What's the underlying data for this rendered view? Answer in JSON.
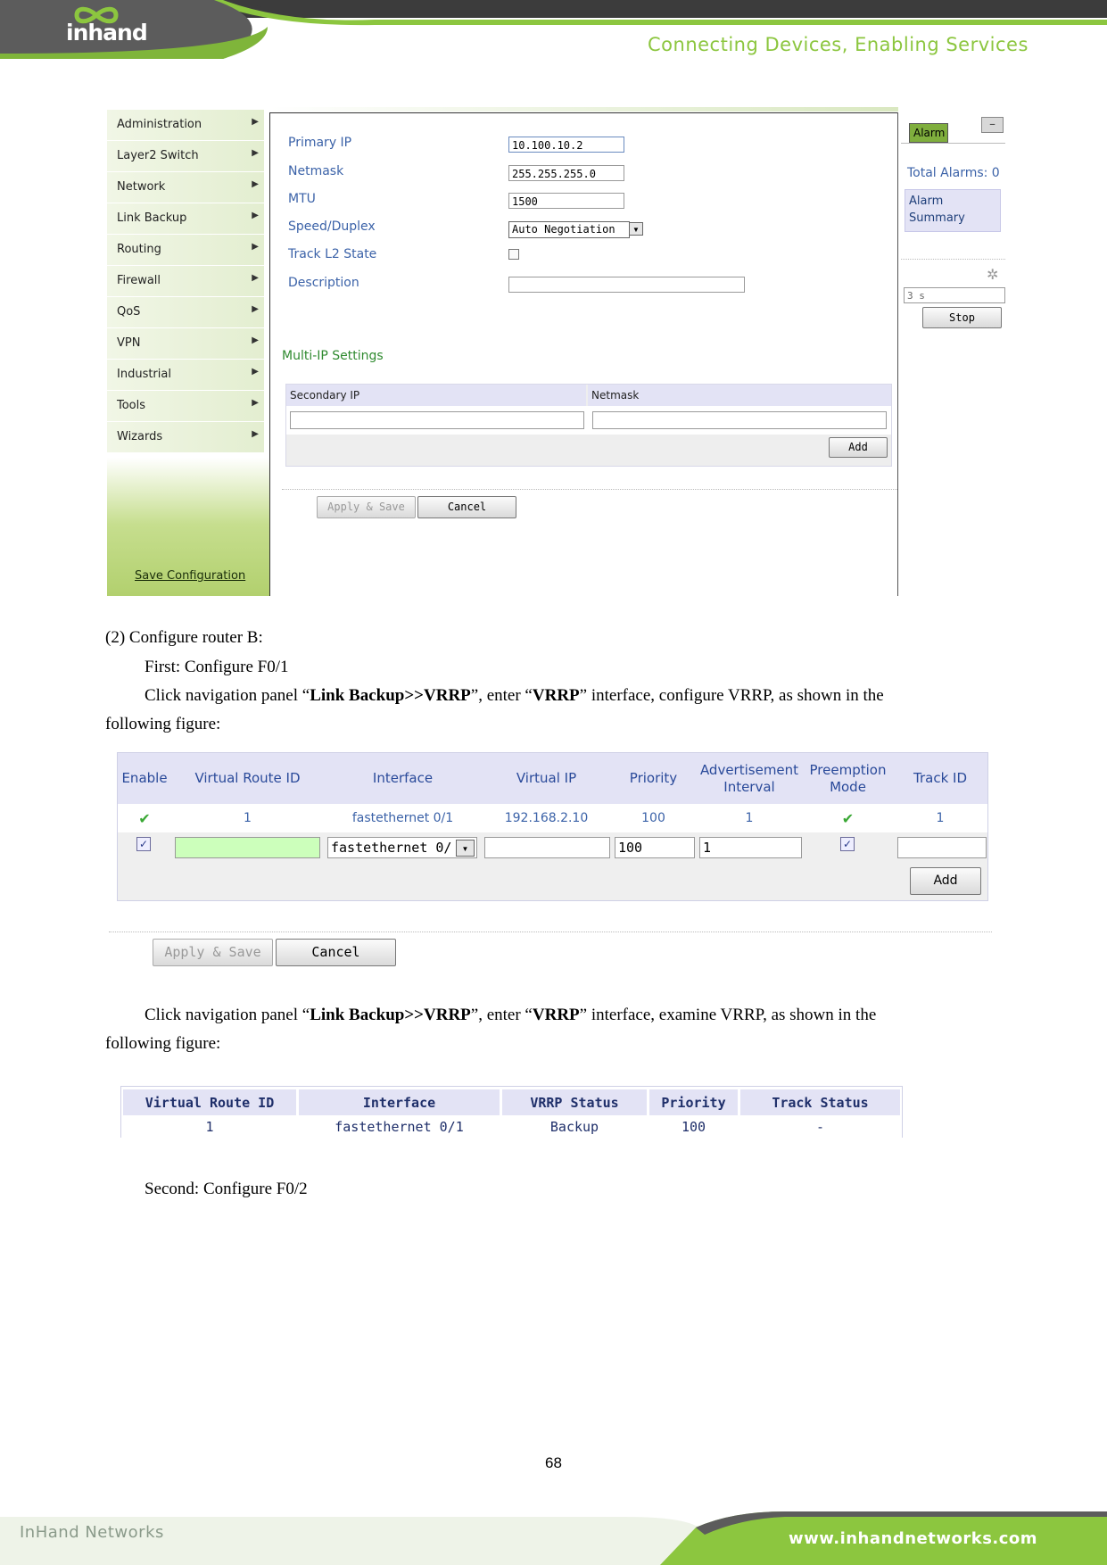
{
  "header": {
    "logo_text": "inhand",
    "tagline": "Connecting Devices, Enabling Services"
  },
  "screenshot1": {
    "nav_items": [
      "Administration",
      "Layer2 Switch",
      "Network",
      "Link Backup",
      "Routing",
      "Firewall",
      "QoS",
      "VPN",
      "Industrial",
      "Tools",
      "Wizards"
    ],
    "save_configuration": "Save Configuration",
    "form": {
      "primary_ip_label": "Primary IP",
      "primary_ip_value": "10.100.10.2",
      "netmask_label": "Netmask",
      "netmask_value": "255.255.255.0",
      "mtu_label": "MTU",
      "mtu_value": "1500",
      "speed_label": "Speed/Duplex",
      "speed_value": "Auto Negotiation",
      "track_label": "Track L2 State",
      "description_label": "Description",
      "description_value": ""
    },
    "multi_ip": {
      "title": "Multi-IP Settings",
      "col_secondary_ip": "Secondary IP",
      "col_netmask": "Netmask",
      "add_label": "Add"
    },
    "apply_save_label": "Apply & Save",
    "cancel_label": "Cancel",
    "alarm": {
      "tab_label": "Alarm",
      "minimize_label": "–",
      "total_alarms": "Total Alarms: 0",
      "summary_line1": "Alarm",
      "summary_line2": "Summary",
      "interval_value": "3 s",
      "stop_label": "Stop"
    }
  },
  "text": {
    "step_b": "(2) Configure router B:",
    "first": "First: Configure F0/1",
    "click1_a": "Click navigation panel “",
    "click1_b": "Link Backup>>VRRP",
    "click1_c": "”, enter “",
    "click1_d": "VRRP",
    "click1_e": "” interface, configure VRRP, as shown in the",
    "click1_f": "following figure:",
    "click2_a": "Click navigation panel “",
    "click2_b": "Link Backup>>VRRP",
    "click2_c": "”, enter “",
    "click2_d": "VRRP",
    "click2_e": "” interface, examine VRRP, as shown in the",
    "click2_f": "following figure:",
    "second": "Second: Configure F0/2"
  },
  "vrrp_config": {
    "headers": [
      "Enable",
      "Virtual Route ID",
      "Interface",
      "Virtual IP",
      "Priority",
      "Advertisement Interval",
      "Preemption Mode",
      "Track ID"
    ],
    "row": [
      "✔",
      "1",
      "fastethernet 0/1",
      "192.168.2.10",
      "100",
      "1",
      "✔",
      "1"
    ],
    "edit_row": {
      "interface": "fastethernet 0/",
      "priority": "100",
      "interval": "1"
    },
    "add_label": "Add",
    "apply_save_label": "Apply & Save",
    "cancel_label": "Cancel"
  },
  "vrrp_status": {
    "headers": [
      "Virtual Route ID",
      "Interface",
      "VRRP Status",
      "Priority",
      "Track Status"
    ],
    "row": [
      "1",
      "fastethernet 0/1",
      "Backup",
      "100",
      "-"
    ]
  },
  "footer": {
    "page_number": "68",
    "left": "InHand Networks",
    "right": "www.inhandnetworks.com"
  },
  "colors": {
    "brand_green": "#8cc63f",
    "header_dark": "#3c3c3c",
    "label_blue": "#3b62a8",
    "grid_header": "#e3e3f5"
  }
}
